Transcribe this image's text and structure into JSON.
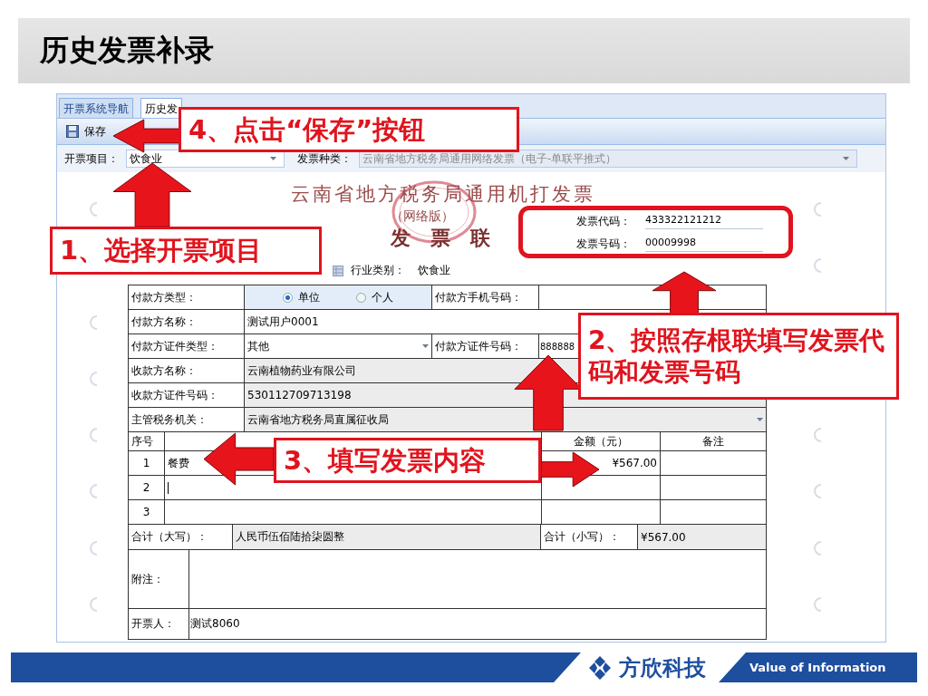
{
  "slide_title": "历史发票补录",
  "window": {
    "tabs": [
      {
        "label": "开票系统导航",
        "selected": false
      },
      {
        "label": "历史发",
        "selected": true
      }
    ],
    "toolbar": [
      {
        "label": "保存"
      }
    ],
    "filters": [
      {
        "label": "开票项目：",
        "value": "饮食业",
        "disabled": false
      },
      {
        "label": "发票种类：",
        "value": "云南省地方税务局通用网络发票（电子-单联平推式）",
        "disabled": true
      }
    ],
    "invoice": {
      "title": "云南省地方税务局通用机打发票",
      "edition": "（网络版）",
      "copy": "发　票　联",
      "numbers": [
        {
          "label": "发票代码：",
          "value": "433322121212"
        },
        {
          "label": "发票号码：",
          "value": "00009998"
        }
      ],
      "industry": {
        "label": "行业类别：",
        "value": "饮食业"
      },
      "rows": [
        {
          "label": "付款方类型：",
          "kind": "radio",
          "options": [
            {
              "label": "单位",
              "selected": true
            },
            {
              "label": "个人",
              "selected": false
            }
          ],
          "side": {
            "label": "付款方手机号码："
          }
        },
        {
          "label": "付款方名称：",
          "kind": "text",
          "value": "测试用户0001"
        },
        {
          "label": "付款方证件类型：",
          "kind": "select",
          "value": "其他",
          "side": {
            "label": "付款方证件号码：",
            "value": "888888"
          }
        },
        {
          "label": "收款方名称：",
          "kind": "readonly",
          "value": "云南植物药业有限公司"
        },
        {
          "label": "收款方证件号码：",
          "kind": "readonly",
          "value": "530112709713198"
        },
        {
          "label": "主管税务机关：",
          "kind": "readonly_select",
          "value": "云南省地方税务局直属征收局"
        }
      ],
      "items": {
        "columns": {
          "index": "序号",
          "amount": "金额（元）",
          "note": "备注"
        },
        "rows": [
          {
            "index": "1",
            "name": "餐费",
            "amount": "¥567.00",
            "focused": false
          },
          {
            "index": "2",
            "focused": true
          },
          {
            "index": "3",
            "focused": false
          }
        ]
      },
      "totals": {
        "words_label": "合计（大写）：",
        "words": "人民币伍佰陆拾柒圆整",
        "figures_label": "合计（小写）：",
        "figures": "¥567.00"
      },
      "remark": {
        "label": "附注："
      },
      "drawer": {
        "label": "开票人：",
        "value": "测试8060"
      }
    }
  },
  "callouts": [
    {
      "text": "4、点击“保存”按钮"
    },
    {
      "text": "1、选择开票项目"
    },
    {
      "text": "2、按照存根联填写发票代码和发票号码"
    },
    {
      "text": "3、填写发票内容"
    }
  ],
  "footer": {
    "brand": "方欣科技",
    "slogan": "Value of Information"
  }
}
